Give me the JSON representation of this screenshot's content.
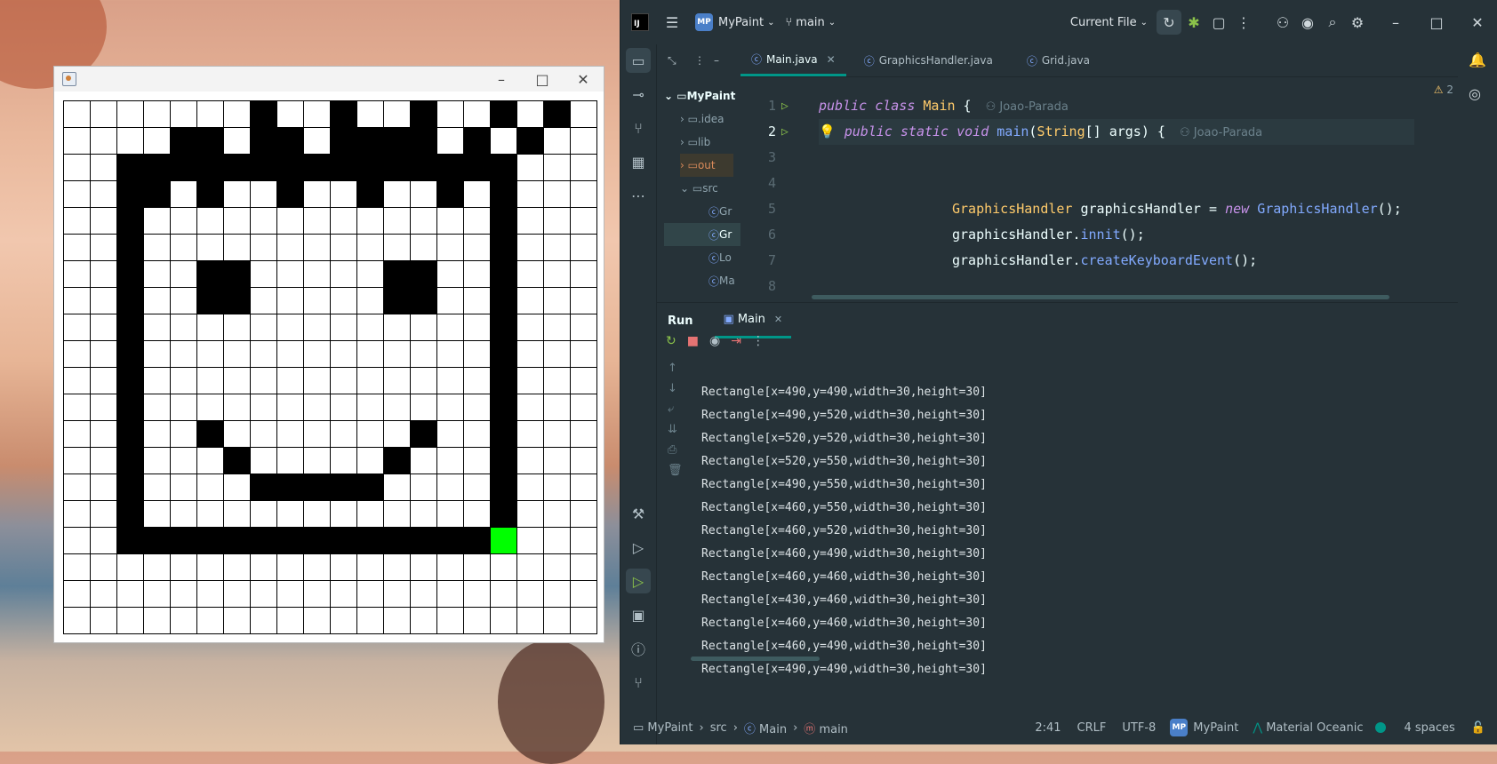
{
  "paint_window": {
    "minimize": "–",
    "maximize": "□",
    "close": "✕",
    "grid": {
      "rows": 20,
      "cols": 20,
      "black_rows": [
        [
          7,
          10,
          13,
          16,
          18
        ],
        [
          4,
          5,
          7,
          8,
          10,
          11,
          12,
          13,
          15,
          17
        ],
        [
          2,
          3,
          4,
          5,
          6,
          7,
          8,
          9,
          10,
          11,
          12,
          13,
          14,
          15,
          16
        ],
        [
          2,
          3,
          5,
          8,
          11,
          14,
          16
        ],
        [
          2,
          16
        ],
        [
          2,
          16
        ],
        [
          2,
          5,
          6,
          12,
          13,
          16
        ],
        [
          2,
          5,
          6,
          12,
          13,
          16
        ],
        [
          2,
          16
        ],
        [
          2,
          16
        ],
        [
          2,
          16
        ],
        [
          2,
          16
        ],
        [
          2,
          5,
          13,
          16
        ],
        [
          2,
          6,
          12,
          16
        ],
        [
          2,
          7,
          8,
          9,
          10,
          11,
          16
        ],
        [
          2,
          16
        ],
        [
          2,
          3,
          4,
          5,
          6,
          7,
          8,
          9,
          10,
          11,
          12,
          13,
          14,
          15
        ],
        [],
        [],
        []
      ],
      "green_cell": {
        "row": 16,
        "col": 16
      },
      "green_color": "#00ff00"
    }
  },
  "ide": {
    "project_badge": "MP",
    "project_name": "MyPaint",
    "branch": "main",
    "run_config": "Current File",
    "tabs": [
      "Main.java",
      "GraphicsHandler.java",
      "Grid.java"
    ],
    "project_tree": [
      ".idea",
      "lib",
      "out",
      "src",
      "Gr",
      "Gr",
      "Lo",
      "Ma"
    ],
    "tree_root": "MyPaint",
    "warnings_count": "2",
    "code_lines": [
      {
        "n": "1",
        "author": "Joao-Parada"
      },
      {
        "n": "2",
        "author": "Joao-Parada"
      },
      {
        "n": "3"
      },
      {
        "n": "4"
      },
      {
        "n": "5"
      },
      {
        "n": "6"
      },
      {
        "n": "7"
      },
      {
        "n": "8"
      }
    ],
    "code": {
      "l1_kw": "public class ",
      "l1_name": "Main",
      "l1_rest": " {",
      "l2_kw": "public static void ",
      "l2_fn": "main",
      "l2_p1": "(",
      "l2_type": "String",
      "l2_p2": "[] args) {",
      "l5_type": "GraphicsHandler",
      "l5_var": " graphicsHandler = ",
      "l5_new": "new ",
      "l5_ctor": "GraphicsHandler",
      "l5_end": "();",
      "l6_var": "graphicsHandler.",
      "l6_fn": "innit",
      "l6_end": "();",
      "l7_var": "graphicsHandler.",
      "l7_fn": "createKeyboardEvent",
      "l7_end": "();"
    },
    "run": {
      "title": "Run",
      "tab": "Main",
      "output": [
        "Rectangle[x=490,y=490,width=30,height=30]",
        "Rectangle[x=490,y=520,width=30,height=30]",
        "Rectangle[x=520,y=520,width=30,height=30]",
        "Rectangle[x=520,y=550,width=30,height=30]",
        "Rectangle[x=490,y=550,width=30,height=30]",
        "Rectangle[x=460,y=550,width=30,height=30]",
        "Rectangle[x=460,y=520,width=30,height=30]",
        "Rectangle[x=460,y=490,width=30,height=30]",
        "Rectangle[x=460,y=460,width=30,height=30]",
        "Rectangle[x=430,y=460,width=30,height=30]",
        "Rectangle[x=460,y=460,width=30,height=30]",
        "Rectangle[x=460,y=490,width=30,height=30]",
        "Rectangle[x=490,y=490,width=30,height=30]"
      ]
    },
    "status": {
      "crumbs": [
        "MyPaint",
        "src",
        "Main",
        "main"
      ],
      "position": "2:41",
      "line_sep": "CRLF",
      "encoding": "UTF-8",
      "project_badge": "MP",
      "project": "MyPaint",
      "theme": "Material Oceanic",
      "indent": "4 spaces"
    }
  }
}
